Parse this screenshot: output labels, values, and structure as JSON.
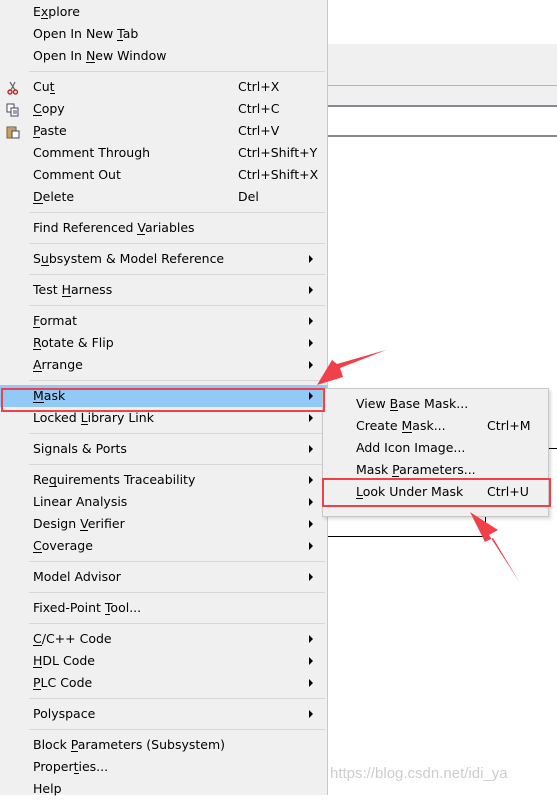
{
  "menu": {
    "groups": [
      [
        {
          "label": "Explore",
          "mn": 1
        },
        {
          "label": "Open In New Tab",
          "mn": 12
        },
        {
          "label": "Open In New Window",
          "mn": 8
        }
      ],
      [
        {
          "label": "Cut",
          "mn": 2,
          "shortcut": "Ctrl+X",
          "icon": "scissors-icon"
        },
        {
          "label": "Copy",
          "mn": 0,
          "shortcut": "Ctrl+C",
          "icon": "copy-icon"
        },
        {
          "label": "Paste",
          "mn": 0,
          "shortcut": "Ctrl+V",
          "icon": "paste-icon"
        },
        {
          "label": "Comment Through",
          "shortcut": "Ctrl+Shift+Y"
        },
        {
          "label": "Comment Out",
          "shortcut": "Ctrl+Shift+X"
        },
        {
          "label": "Delete",
          "mn": 0,
          "shortcut": "Del"
        }
      ],
      [
        {
          "label": "Find Referenced Variables",
          "mn": 16
        }
      ],
      [
        {
          "label": "Subsystem & Model Reference",
          "mn": 1,
          "submenu": true
        }
      ],
      [
        {
          "label": "Test Harness",
          "mn": 5,
          "submenu": true
        }
      ],
      [
        {
          "label": "Format",
          "mn": 0,
          "submenu": true
        },
        {
          "label": "Rotate & Flip",
          "mn": 0,
          "submenu": true
        },
        {
          "label": "Arrange",
          "mn": 0,
          "submenu": true
        }
      ],
      [
        {
          "label": "Mask",
          "mn": 0,
          "submenu": true,
          "highlighted": true
        },
        {
          "label": "Locked Library Link",
          "mn": 7,
          "submenu": true
        }
      ],
      [
        {
          "label": "Signals & Ports",
          "submenu": true
        }
      ],
      [
        {
          "label": "Requirements Traceability",
          "mn": 2,
          "submenu": true
        },
        {
          "label": "Linear Analysis",
          "submenu": true
        },
        {
          "label": "Design Verifier",
          "mn": 7,
          "submenu": true
        },
        {
          "label": "Coverage",
          "mn": 0,
          "submenu": true
        }
      ],
      [
        {
          "label": "Model Advisor",
          "submenu": true
        }
      ],
      [
        {
          "label": "Fixed-Point Tool...",
          "mn": 12
        }
      ],
      [
        {
          "label": "C/C++ Code",
          "mn": 0,
          "submenu": true
        },
        {
          "label": "HDL Code",
          "mn": 0,
          "submenu": true
        },
        {
          "label": "PLC Code",
          "mn": 0,
          "submenu": true
        }
      ],
      [
        {
          "label": "Polyspace",
          "submenu": true
        }
      ],
      [
        {
          "label": "Block Parameters (Subsystem)",
          "mn": 6
        },
        {
          "label": "Properties...",
          "mn": 6
        },
        {
          "label": "Help"
        }
      ]
    ]
  },
  "submenu": {
    "items": [
      {
        "label": "View Base Mask...",
        "mn": 5
      },
      {
        "label": "Create Mask...",
        "shortcut": "Ctrl+M",
        "mn": 7
      },
      {
        "label": "Add Icon Image..."
      },
      {
        "label": "Mask Parameters...",
        "mn": 5
      },
      {
        "label": "Look Under Mask",
        "shortcut": "Ctrl+U",
        "mn": 0
      }
    ]
  },
  "colors": {
    "highlight": "#91c9f7",
    "annotation": "#f0404a",
    "menu_bg": "#f0f0f0"
  },
  "watermark": "https://blog.csdn.net/idi_ya"
}
